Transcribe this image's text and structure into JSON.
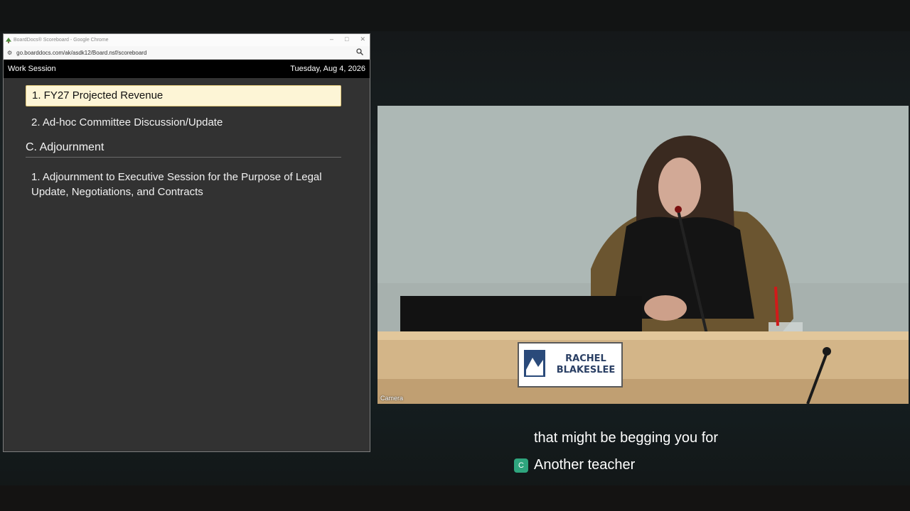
{
  "browser": {
    "window_title": "BoardDocs® Scoreboard - Google Chrome",
    "url": "go.boarddocs.com/ak/asdk12/Board.nsf/scoreboard",
    "icons": {
      "favicon": "tree-icon",
      "site_info": "tune-icon",
      "zoom": "magnifier-icon"
    },
    "window_controls": {
      "minimize": "–",
      "maximize": "□",
      "close": "✕"
    }
  },
  "board": {
    "meeting_type": "Work Session",
    "date": "Tuesday, Aug 4, 2026",
    "items": [
      {
        "label": "1. FY27 Projected Revenue",
        "active": true
      },
      {
        "label": "2. Ad-hoc Committee Discussion/Update",
        "active": false
      }
    ],
    "section": {
      "title": "C. Adjournment",
      "items": [
        {
          "label": "1. Adjournment to Executive Session for the Purpose of Legal Update, Negotiations, and Contracts"
        }
      ]
    }
  },
  "video": {
    "name_plate_line1": "RACHEL",
    "name_plate_line2": "BLAKESLEE",
    "camera_label": "Camera"
  },
  "captions": {
    "line1": "that might be begging you for",
    "line2": "Another teacher",
    "badge": "C",
    "badge_color": "#2fa57e"
  },
  "colors": {
    "active_item_bg": "#fdf5d6",
    "panel_bg": "#323232",
    "header_bg": "#000000"
  }
}
